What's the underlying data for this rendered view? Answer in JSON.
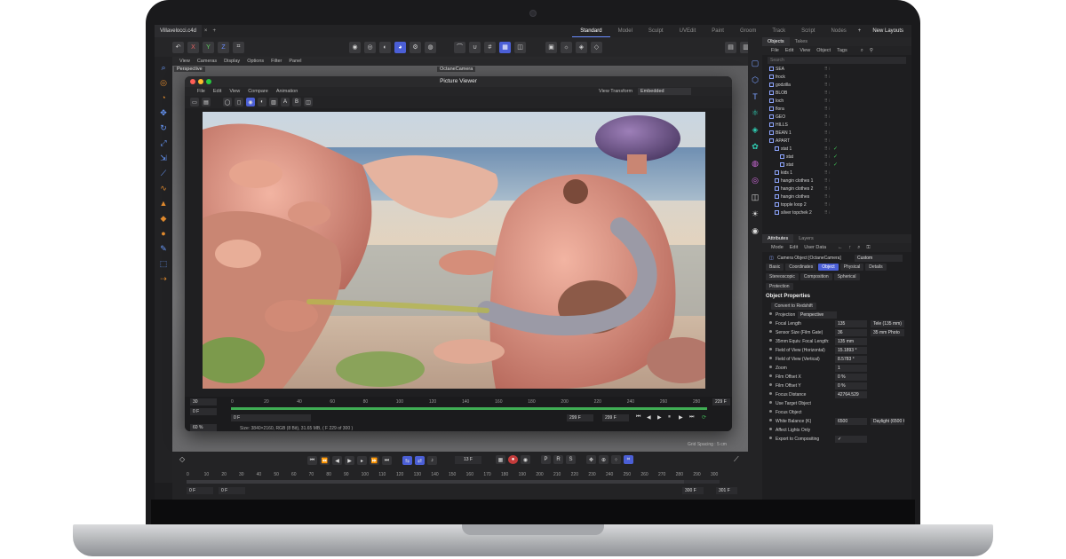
{
  "colors": {
    "accent": "#4b5fd6",
    "green": "#3fae54",
    "teal": "#2fd0b5",
    "orange": "#e08a2e"
  },
  "topbar": {
    "file_tab": "Villavelocci.c4d",
    "layouts": [
      "Standard",
      "Model",
      "Sculpt",
      "UVEdit",
      "Paint",
      "Groom",
      "Track",
      "Script",
      "Nodes"
    ],
    "new_layouts": "New Layouts"
  },
  "viewport": {
    "menu": [
      "View",
      "Cameras",
      "Display",
      "Options",
      "Filter",
      "Panel"
    ],
    "label": "Perspective",
    "camera": "OctaneCamera",
    "grid_spacing": "Grid Spacing : 5 cm"
  },
  "picture_viewer": {
    "title": "Picture Viewer",
    "menu": [
      "File",
      "Edit",
      "View",
      "Compare",
      "Animation"
    ],
    "view_transform_label": "View Transform",
    "view_transform_value": "Embedded",
    "ticks": [
      "0",
      "20",
      "40",
      "60",
      "80",
      "100",
      "120",
      "140",
      "160",
      "180",
      "200",
      "220",
      "240",
      "260",
      "280"
    ],
    "fps": "30",
    "start_frame": "0 F",
    "end_frame_a": "299 F",
    "end_frame_b": "299 F",
    "current_frame": "229 F",
    "zoom": "60 %",
    "info": "Size: 3840×2160, RGB (8 Bit), 31.65 MB,  ( F 229 of 300 )"
  },
  "timeline": {
    "frame": "13 F",
    "ticks": [
      "0",
      "10",
      "20",
      "30",
      "40",
      "50",
      "60",
      "70",
      "80",
      "90",
      "100",
      "110",
      "120",
      "130",
      "140",
      "150",
      "160",
      "170",
      "180",
      "190",
      "200",
      "210",
      "220",
      "230",
      "240",
      "250",
      "260",
      "270",
      "280",
      "290",
      "300"
    ],
    "start_a": "0 F",
    "start_b": "0 F",
    "end_a": "300 F",
    "end_b": "301 F"
  },
  "objects": {
    "tabs": [
      "Objects",
      "Takes"
    ],
    "menu": [
      "File",
      "Edit",
      "View",
      "Object",
      "Tags"
    ],
    "search": "Search",
    "rows": [
      "SEA",
      "frock",
      "godzilla",
      "BLOB",
      "loch",
      "flora",
      "GEO",
      "HILLS",
      "BEAN 1",
      "APART",
      "stat 1",
      "stat",
      "stat",
      "kids 1",
      "hangin clothes 1",
      "hangin clothes 2",
      "hangin clothes",
      "topple loop 2",
      "silver topchek 2"
    ]
  },
  "attributes": {
    "tabs": [
      "Attributes",
      "Layers"
    ],
    "menu": [
      "Mode",
      "Edit",
      "User Data"
    ],
    "object_label": "Camera Object [OctaneCamera]",
    "object_dropdown": "Custom",
    "prop_tabs": [
      "Basic",
      "Coordinates",
      "Object",
      "Physical",
      "Details"
    ],
    "prop_tabs2": [
      "Stereoscopic",
      "Composition",
      "Spherical"
    ],
    "protection": "Protection",
    "section": "Object Properties",
    "convert_btn": "Convert to Redshift",
    "projection_label": "Projection",
    "projection_value": "Perspective",
    "fields": [
      {
        "label": "Focal Length",
        "value": "135",
        "extra": "Tele (135 mm)"
      },
      {
        "label": "Sensor Size (Film Gate)",
        "value": "36",
        "extra": "35 mm Photo"
      },
      {
        "label": "35mm Equiv. Focal Length:",
        "value": "135 mm",
        "extra": ""
      },
      {
        "label": "Field of View (Horizontal)",
        "value": "15.1893 °",
        "extra": ""
      },
      {
        "label": "Field of View (Vertical)",
        "value": "8.5783 °",
        "extra": ""
      },
      {
        "label": "Zoom",
        "value": "1",
        "extra": ""
      },
      {
        "label": "Film Offset X",
        "value": "0 %",
        "extra": ""
      },
      {
        "label": "Film Offset Y",
        "value": "0 %",
        "extra": ""
      },
      {
        "label": "Focus Distance",
        "value": "42764.529",
        "extra": ""
      },
      {
        "label": "Use Target Object",
        "value": "",
        "extra": ""
      },
      {
        "label": "Focus Object",
        "value": "",
        "extra": ""
      },
      {
        "label": "White Balance (K)",
        "value": "6500",
        "extra": "Daylight (6500 K)"
      },
      {
        "label": "Affect Lights Only",
        "value": "",
        "extra": ""
      },
      {
        "label": "Export to Compositing",
        "value": "✓",
        "extra": ""
      }
    ]
  }
}
